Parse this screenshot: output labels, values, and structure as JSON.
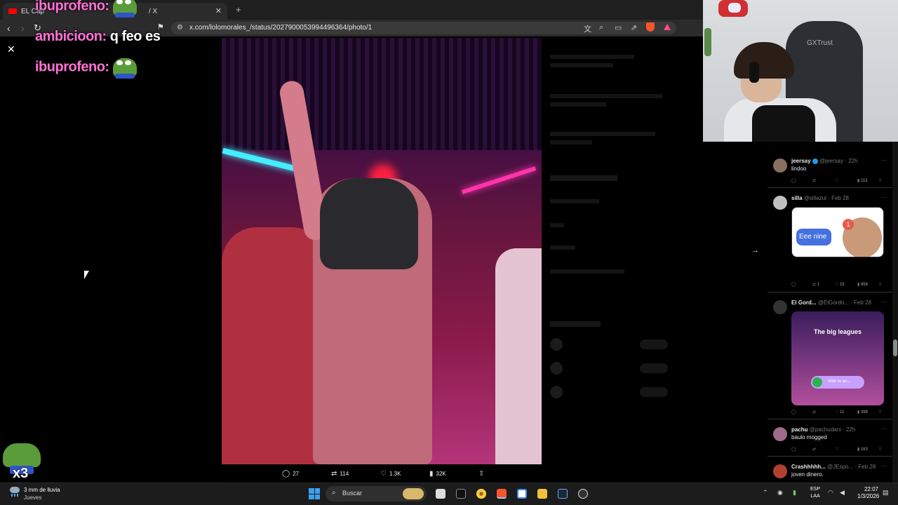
{
  "browser": {
    "tab_title": "EL Cap",
    "tab_suffix": "/ X",
    "url": "x.com/lolomorales_/status/2027900053994496364/photo/1"
  },
  "chat": [
    {
      "user": "ibuprofeno:",
      "message": ""
    },
    {
      "user": "ambicioon:",
      "message": "q feo es"
    },
    {
      "user": "ibuprofeno:",
      "message": ""
    }
  ],
  "photo_actions": {
    "replies": "27",
    "reposts": "114",
    "likes": "1.3K",
    "views": "32K"
  },
  "webcam": {
    "chair_brand": "GXTrust"
  },
  "feed": [
    {
      "name": "jeersay",
      "handle": "@jeersay",
      "time": "22h",
      "verified": true,
      "text": "lindoo",
      "reposts": "",
      "likes": "",
      "views": "112"
    },
    {
      "name": "silla",
      "handle": "@sillazul",
      "time": "Feb 28",
      "verified": false,
      "text": "",
      "media_text": "Eee nine",
      "media_badge": "1",
      "reposts": "1",
      "likes": "15",
      "views": "858"
    },
    {
      "name": "El Gord...",
      "handle": "@ElGordo...",
      "time": "Feb 28",
      "verified": false,
      "text": "",
      "media_title": "The big leagues",
      "media_slider": "slide to an...",
      "reposts": "",
      "likes": "11",
      "views": "399"
    },
    {
      "name": "pachu",
      "handle": "@pachudani",
      "time": "22h",
      "verified": false,
      "text": "baulo mogged",
      "reposts": "",
      "likes": "",
      "views": "163"
    },
    {
      "name": "Crashhhhh...",
      "handle": "@JEspo...",
      "time": "Feb 28",
      "verified": false,
      "text": "joven dinero."
    }
  ],
  "overlay": {
    "emote_count": "x3"
  },
  "taskbar": {
    "weather_title": "3 mm de lluvia",
    "weather_sub": "Jueves",
    "search_placeholder": "Buscar",
    "lang_top": "ESP",
    "lang_bottom": "LAA",
    "time": "22:07",
    "date": "1/3/2026"
  }
}
